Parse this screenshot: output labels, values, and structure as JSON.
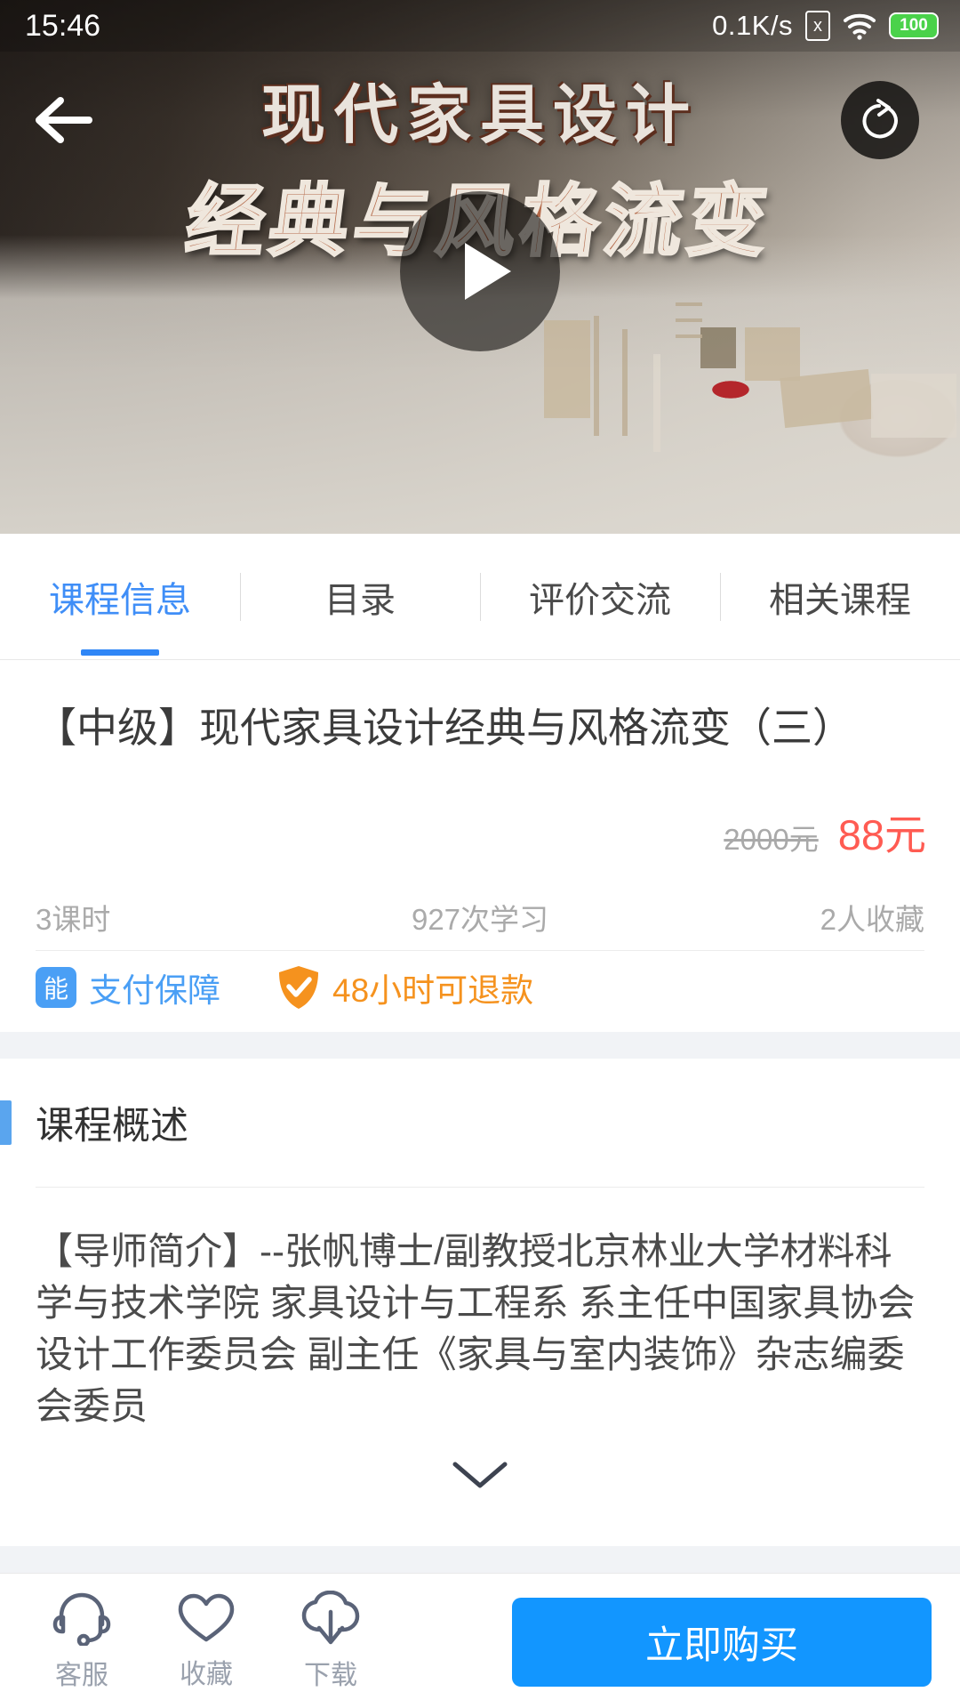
{
  "status_bar": {
    "time": "15:46",
    "network_speed": "0.1K/s",
    "sim_icon": "sim-disabled-icon",
    "sim_glyph": "x",
    "wifi_icon": "wifi-icon",
    "battery_level": "100"
  },
  "hero": {
    "back_icon": "back-arrow-icon",
    "share_icon": "share-icon",
    "play_icon": "play-icon",
    "cover_title_line1": "现代家具设计",
    "cover_title_line2": "经典与风格流变"
  },
  "tabs": [
    {
      "label": "课程信息",
      "active": true
    },
    {
      "label": "目录",
      "active": false
    },
    {
      "label": "评价交流",
      "active": false
    },
    {
      "label": "相关课程",
      "active": false
    }
  ],
  "course": {
    "title": "【中级】现代家具设计经典与风格流变（三）",
    "price_original": "2000元",
    "price_current": "88元",
    "lessons": "3课时",
    "studies": "927次学习",
    "favorites": "2人收藏",
    "badge_pay": {
      "icon": "pay-guarantee-icon",
      "icon_glyph": "能",
      "label": "支付保障"
    },
    "badge_refund": {
      "icon": "shield-check-icon",
      "label": "48小时可退款"
    }
  },
  "overview": {
    "heading": "课程概述",
    "body": "【导师简介】--张帆博士/副教授北京林业大学材料科学与技术学院 家具设计与工程系 系主任中国家具协会设计工作委员会 副主任《家具与室内装饰》杂志编委会委员",
    "expand_icon": "chevron-down-icon"
  },
  "bottom_bar": {
    "items": [
      {
        "icon": "headset-icon",
        "label": "客服"
      },
      {
        "icon": "heart-icon",
        "label": "收藏"
      },
      {
        "icon": "cloud-download-icon",
        "label": "下载"
      }
    ],
    "buy_label": "立即购买"
  },
  "colors": {
    "accent_blue": "#1296ff",
    "tab_active": "#3f8ef7",
    "price_red": "#ff5b52",
    "badge_blue": "#4a9ff5",
    "badge_orange": "#f5921e",
    "section_bar": "#5aa5ee",
    "spacer_gray": "#f1f3f6"
  }
}
